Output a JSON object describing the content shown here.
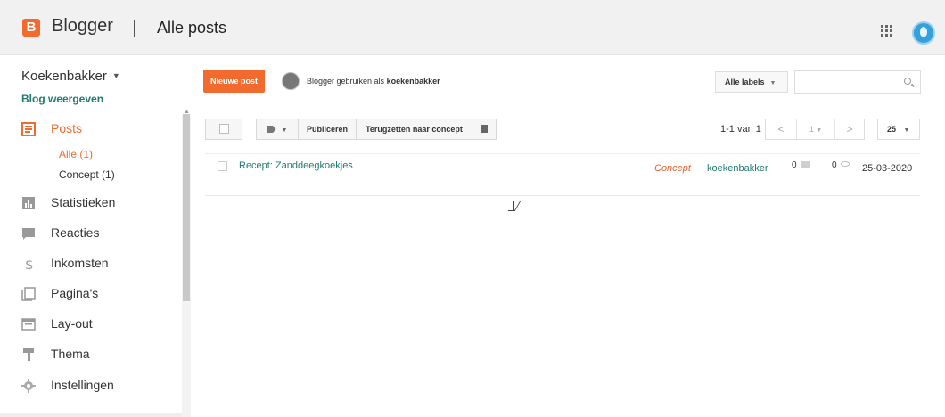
{
  "header": {
    "brand": "Blogger",
    "page_title": "Alle posts"
  },
  "sidebar": {
    "blog_name": "Koekenbakker",
    "blog_view_link": "Blog weergeven",
    "items": [
      {
        "label": "Posts",
        "icon": "posts-icon",
        "active": true
      },
      {
        "label": "Statistieken",
        "icon": "stats-icon"
      },
      {
        "label": "Reacties",
        "icon": "comments-icon"
      },
      {
        "label": "Inkomsten",
        "icon": "dollar-icon"
      },
      {
        "label": "Pagina's",
        "icon": "pages-icon"
      },
      {
        "label": "Lay-out",
        "icon": "layout-icon"
      },
      {
        "label": "Thema",
        "icon": "theme-icon"
      },
      {
        "label": "Instellingen",
        "icon": "gear-icon"
      }
    ],
    "sub_items": [
      {
        "label": "Alle (1)",
        "active": true
      },
      {
        "label": "Concept (1)"
      }
    ]
  },
  "actions": {
    "new_post": "Nieuwe post",
    "user_prefix": "Blogger gebruiken als",
    "username": "koekenbakker",
    "labels_button": "Alle labels",
    "search_placeholder": ""
  },
  "toolbar": {
    "publish": "Publiceren",
    "revert_draft": "Terugzetten naar concept",
    "count": "1-1 van 1",
    "page": "1",
    "per_page": "25"
  },
  "posts": [
    {
      "title": "Recept: Zanddeegkoekjes",
      "status": "Concept",
      "author": "koekenbakker",
      "comments": "0",
      "views": "0",
      "date": "25-03-2020"
    }
  ],
  "colors": {
    "accent": "#f26a2e",
    "link": "#1f7a72"
  }
}
